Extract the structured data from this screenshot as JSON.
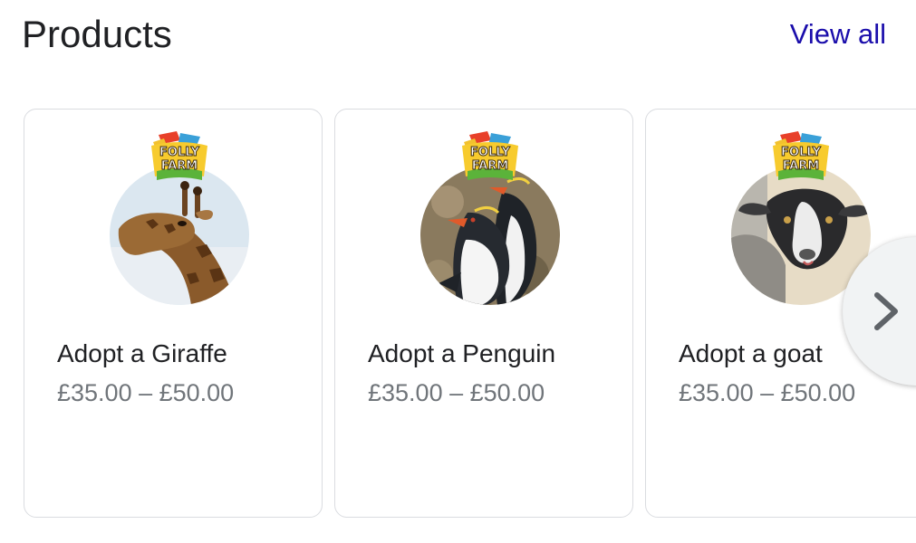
{
  "header": {
    "title": "Products",
    "view_all_label": "View all"
  },
  "products": [
    {
      "name": "Adopt a Giraffe",
      "price": "£35.00 – £50.00",
      "image_icon": "giraffe-icon",
      "logo_text": [
        "FOLLY",
        "FARM"
      ]
    },
    {
      "name": "Adopt a Penguin",
      "price": "£35.00 – £50.00",
      "image_icon": "penguin-icon",
      "logo_text": [
        "FOLLY",
        "FARM"
      ]
    },
    {
      "name": "Adopt a goat",
      "price": "£35.00 – £50.00",
      "image_icon": "goat-icon",
      "logo_text": [
        "FOLLY",
        "FARM"
      ]
    }
  ],
  "carousel": {
    "next_icon": "chevron-right-icon"
  },
  "colors": {
    "title": "#202124",
    "link": "#1a0dab",
    "price": "#70757a",
    "card_border": "#dadce0"
  }
}
